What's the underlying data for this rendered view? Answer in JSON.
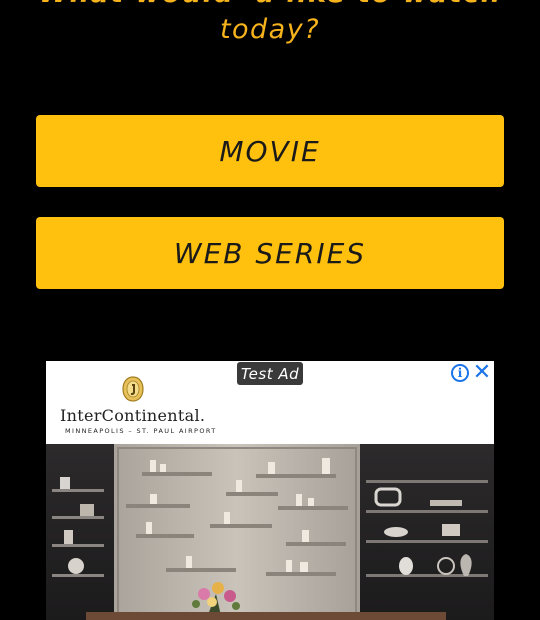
{
  "question": {
    "line1": "What would 'u like to watch",
    "line2": "today?"
  },
  "buttons": {
    "movie": "MOVIE",
    "web_series": "WEB SERIES"
  },
  "ad": {
    "badge": "Test Ad",
    "info_icon": "info-icon",
    "close_icon": "close-icon",
    "brand_name": "InterContinental.",
    "brand_location": "MINNEAPOLIS – ST. PAUL AIRPORT"
  },
  "colors": {
    "background": "#000000",
    "accent": "#ffc10e",
    "question_text": "#f7b31c",
    "ad_icon_blue": "#1a73e8"
  }
}
